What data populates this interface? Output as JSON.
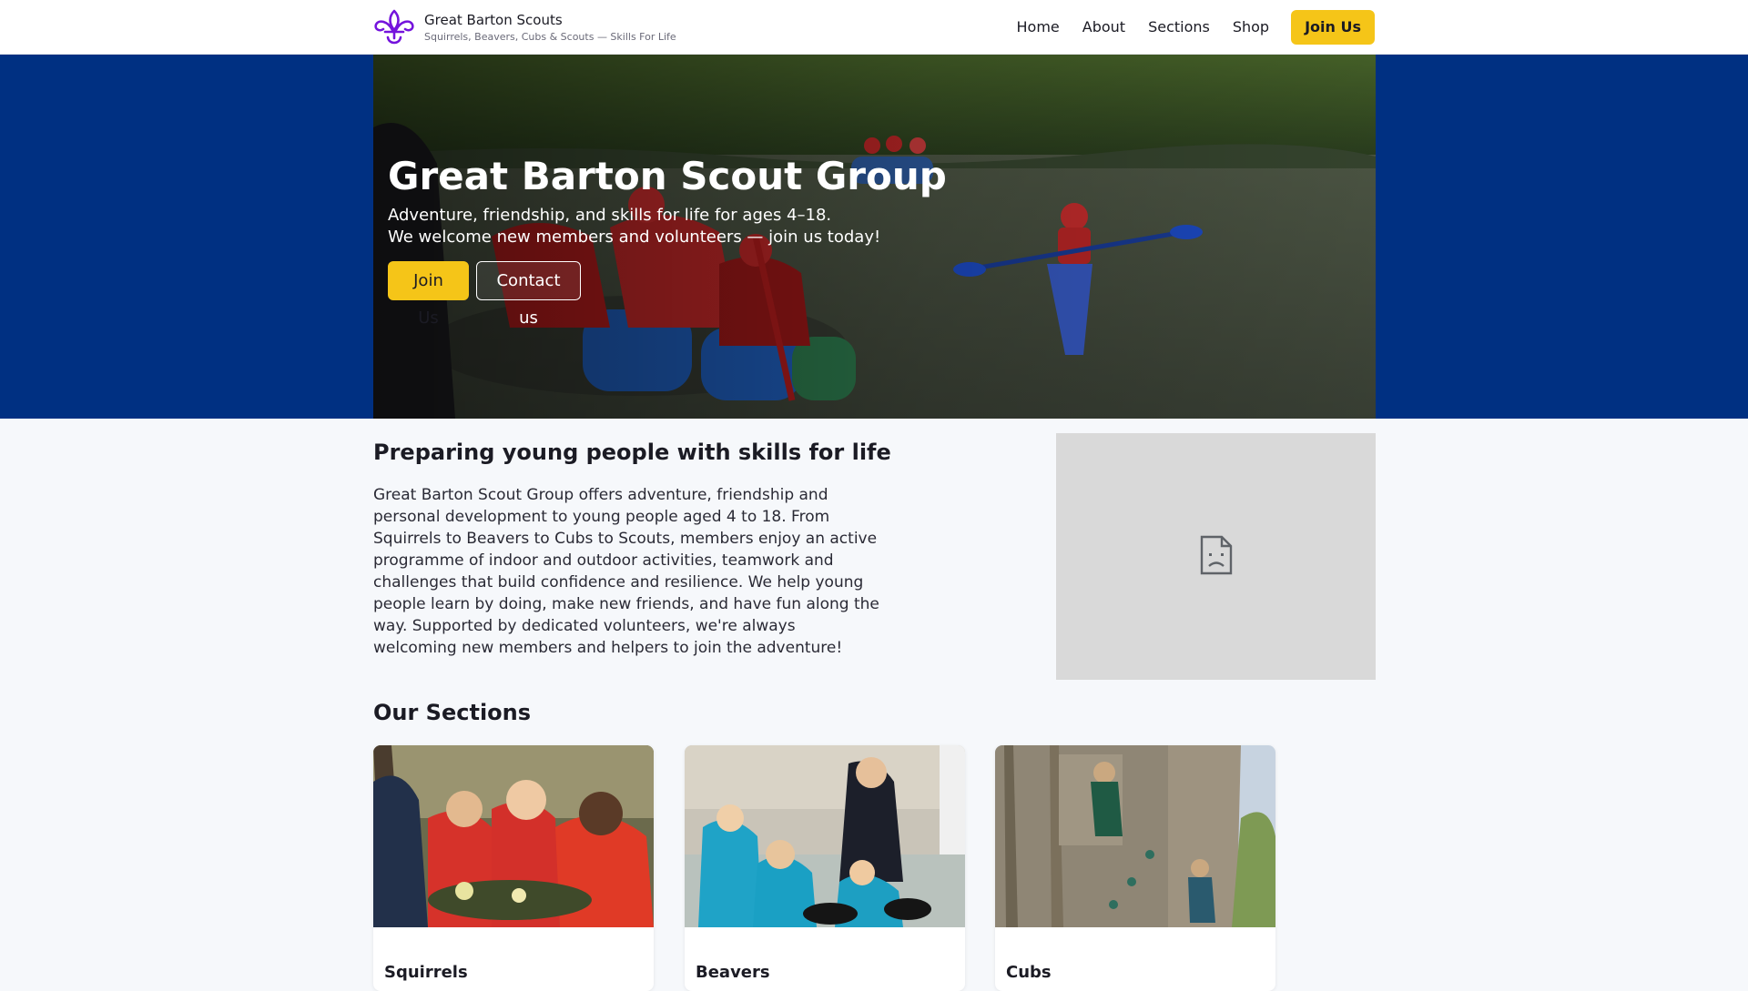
{
  "header": {
    "title": "Great Barton Scouts",
    "subtitle": "Squirrels, Beavers, Cubs & Scouts — Skills For Life",
    "logo_icon": "fleur-de-lis-icon",
    "nav": [
      {
        "label": "Home"
      },
      {
        "label": "About"
      },
      {
        "label": "Sections"
      },
      {
        "label": "Shop"
      }
    ],
    "join_label": "Join Us"
  },
  "hero": {
    "title": "Great Barton Scout Group",
    "line1": "Adventure, friendship, and skills for life for ages 4–18.",
    "line2": "We welcome new members and volunteers — join us today!",
    "join_label": "Join Us",
    "contact_label": "Contact us"
  },
  "intro": {
    "heading": "Preparing young people with skills for life",
    "text": "Great Barton Scout Group offers adventure, friendship and personal development to young people aged 4 to 18. From Squirrels to Beavers to Cubs to Scouts, members enjoy an active programme of indoor and outdoor activities, teamwork and challenges that build confidence and resilience. We help young people learn by doing, make new friends, and have fun along the way. Supported by dedicated volunteers, we're always welcoming new members and helpers to join the adventure!",
    "image_icon": "broken-image-icon"
  },
  "sections": {
    "heading": "Our Sections",
    "cards": [
      {
        "title": "Squirrels"
      },
      {
        "title": "Beavers"
      },
      {
        "title": "Cubs"
      }
    ]
  },
  "colors": {
    "brand_blue": "#003082",
    "accent_yellow": "#f5c518",
    "logo_purple": "#7413dc",
    "page_background": "#f6f8fb"
  }
}
